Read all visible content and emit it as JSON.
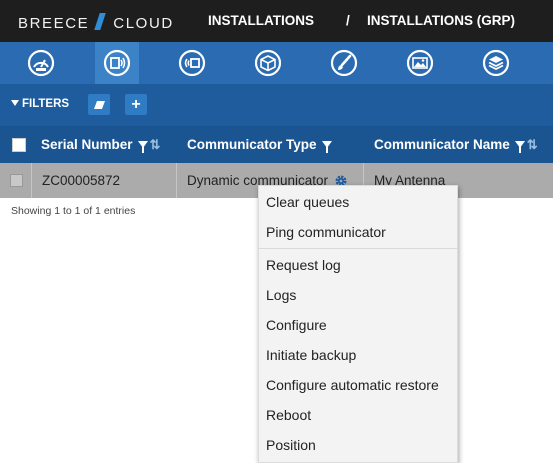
{
  "header": {
    "logo_left": "BREECE",
    "logo_right": "CLOUD",
    "breadcrumb_1": "INSTALLATIONS",
    "breadcrumb_sep": "/",
    "breadcrumb_2": "INSTALLATIONS (GRP)"
  },
  "colors": {
    "accent": "#2a6bb1",
    "header_dark": "#1e1e1e",
    "table_header": "#1a5592"
  },
  "nav_icons": [
    "dashboard-icon",
    "communicator-icon",
    "wireless-icon",
    "box-icon",
    "brush-icon",
    "image-icon",
    "layers-icon"
  ],
  "filterbar": {
    "label": "FILTERS",
    "add_label": "+"
  },
  "table": {
    "columns": [
      "Serial Number",
      "Communicator Type",
      "Communicator Name"
    ],
    "rows": [
      {
        "serial": "ZC00005872",
        "type": "Dynamic communicator",
        "name": "My Antenna"
      }
    ],
    "entries_text": "Showing 1 to 1 of 1 entries"
  },
  "context_menu": {
    "items": [
      "Clear queues",
      "Ping communicator",
      "Request log",
      "Logs",
      "Configure",
      "Initiate backup",
      "Configure automatic restore",
      "Reboot",
      "Position"
    ]
  }
}
